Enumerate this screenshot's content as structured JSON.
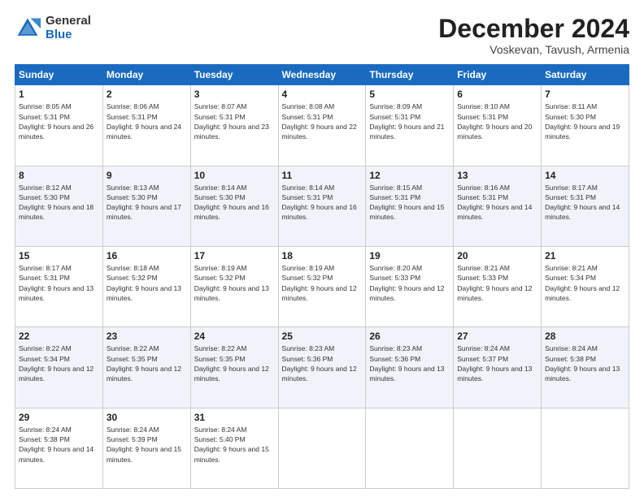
{
  "logo": {
    "general": "General",
    "blue": "Blue"
  },
  "header": {
    "month": "December 2024",
    "location": "Voskevan, Tavush, Armenia"
  },
  "days_of_week": [
    "Sunday",
    "Monday",
    "Tuesday",
    "Wednesday",
    "Thursday",
    "Friday",
    "Saturday"
  ],
  "weeks": [
    [
      {
        "day": "1",
        "sunrise": "8:05 AM",
        "sunset": "5:31 PM",
        "daylight": "9 hours and 26 minutes."
      },
      {
        "day": "2",
        "sunrise": "8:06 AM",
        "sunset": "5:31 PM",
        "daylight": "9 hours and 24 minutes."
      },
      {
        "day": "3",
        "sunrise": "8:07 AM",
        "sunset": "5:31 PM",
        "daylight": "9 hours and 23 minutes."
      },
      {
        "day": "4",
        "sunrise": "8:08 AM",
        "sunset": "5:31 PM",
        "daylight": "9 hours and 22 minutes."
      },
      {
        "day": "5",
        "sunrise": "8:09 AM",
        "sunset": "5:31 PM",
        "daylight": "9 hours and 21 minutes."
      },
      {
        "day": "6",
        "sunrise": "8:10 AM",
        "sunset": "5:31 PM",
        "daylight": "9 hours and 20 minutes."
      },
      {
        "day": "7",
        "sunrise": "8:11 AM",
        "sunset": "5:30 PM",
        "daylight": "9 hours and 19 minutes."
      }
    ],
    [
      {
        "day": "8",
        "sunrise": "8:12 AM",
        "sunset": "5:30 PM",
        "daylight": "9 hours and 18 minutes."
      },
      {
        "day": "9",
        "sunrise": "8:13 AM",
        "sunset": "5:30 PM",
        "daylight": "9 hours and 17 minutes."
      },
      {
        "day": "10",
        "sunrise": "8:14 AM",
        "sunset": "5:30 PM",
        "daylight": "9 hours and 16 minutes."
      },
      {
        "day": "11",
        "sunrise": "8:14 AM",
        "sunset": "5:31 PM",
        "daylight": "9 hours and 16 minutes."
      },
      {
        "day": "12",
        "sunrise": "8:15 AM",
        "sunset": "5:31 PM",
        "daylight": "9 hours and 15 minutes."
      },
      {
        "day": "13",
        "sunrise": "8:16 AM",
        "sunset": "5:31 PM",
        "daylight": "9 hours and 14 minutes."
      },
      {
        "day": "14",
        "sunrise": "8:17 AM",
        "sunset": "5:31 PM",
        "daylight": "9 hours and 14 minutes."
      }
    ],
    [
      {
        "day": "15",
        "sunrise": "8:17 AM",
        "sunset": "5:31 PM",
        "daylight": "9 hours and 13 minutes."
      },
      {
        "day": "16",
        "sunrise": "8:18 AM",
        "sunset": "5:32 PM",
        "daylight": "9 hours and 13 minutes."
      },
      {
        "day": "17",
        "sunrise": "8:19 AM",
        "sunset": "5:32 PM",
        "daylight": "9 hours and 13 minutes."
      },
      {
        "day": "18",
        "sunrise": "8:19 AM",
        "sunset": "5:32 PM",
        "daylight": "9 hours and 12 minutes."
      },
      {
        "day": "19",
        "sunrise": "8:20 AM",
        "sunset": "5:33 PM",
        "daylight": "9 hours and 12 minutes."
      },
      {
        "day": "20",
        "sunrise": "8:21 AM",
        "sunset": "5:33 PM",
        "daylight": "9 hours and 12 minutes."
      },
      {
        "day": "21",
        "sunrise": "8:21 AM",
        "sunset": "5:34 PM",
        "daylight": "9 hours and 12 minutes."
      }
    ],
    [
      {
        "day": "22",
        "sunrise": "8:22 AM",
        "sunset": "5:34 PM",
        "daylight": "9 hours and 12 minutes."
      },
      {
        "day": "23",
        "sunrise": "8:22 AM",
        "sunset": "5:35 PM",
        "daylight": "9 hours and 12 minutes."
      },
      {
        "day": "24",
        "sunrise": "8:22 AM",
        "sunset": "5:35 PM",
        "daylight": "9 hours and 12 minutes."
      },
      {
        "day": "25",
        "sunrise": "8:23 AM",
        "sunset": "5:36 PM",
        "daylight": "9 hours and 12 minutes."
      },
      {
        "day": "26",
        "sunrise": "8:23 AM",
        "sunset": "5:36 PM",
        "daylight": "9 hours and 13 minutes."
      },
      {
        "day": "27",
        "sunrise": "8:24 AM",
        "sunset": "5:37 PM",
        "daylight": "9 hours and 13 minutes."
      },
      {
        "day": "28",
        "sunrise": "8:24 AM",
        "sunset": "5:38 PM",
        "daylight": "9 hours and 13 minutes."
      }
    ],
    [
      {
        "day": "29",
        "sunrise": "8:24 AM",
        "sunset": "5:38 PM",
        "daylight": "9 hours and 14 minutes."
      },
      {
        "day": "30",
        "sunrise": "8:24 AM",
        "sunset": "5:39 PM",
        "daylight": "9 hours and 15 minutes."
      },
      {
        "day": "31",
        "sunrise": "8:24 AM",
        "sunset": "5:40 PM",
        "daylight": "9 hours and 15 minutes."
      },
      null,
      null,
      null,
      null
    ]
  ],
  "labels": {
    "sunrise": "Sunrise:",
    "sunset": "Sunset:",
    "daylight": "Daylight:"
  }
}
